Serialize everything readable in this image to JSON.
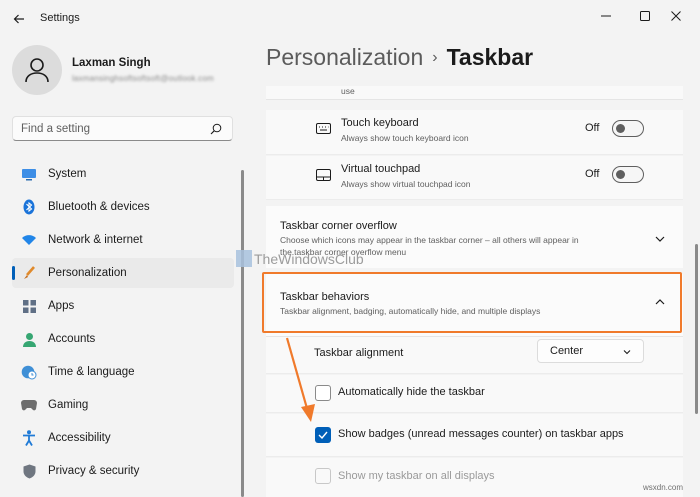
{
  "window": {
    "title": "Settings"
  },
  "profile": {
    "name": "Laxman Singh",
    "email": "laxmansinghsoftsoftsoft@outlook.com"
  },
  "search": {
    "placeholder": "Find a setting"
  },
  "nav": {
    "items": [
      {
        "label": "System",
        "icon": "monitor-icon",
        "active": false
      },
      {
        "label": "Bluetooth & devices",
        "icon": "bluetooth-icon",
        "active": false
      },
      {
        "label": "Network & internet",
        "icon": "wifi-icon",
        "active": false
      },
      {
        "label": "Personalization",
        "icon": "brush-icon",
        "active": true
      },
      {
        "label": "Apps",
        "icon": "apps-grid-icon",
        "active": false
      },
      {
        "label": "Accounts",
        "icon": "person-icon",
        "active": false
      },
      {
        "label": "Time & language",
        "icon": "globe-clock-icon",
        "active": false
      },
      {
        "label": "Gaming",
        "icon": "gamepad-icon",
        "active": false
      },
      {
        "label": "Accessibility",
        "icon": "accessibility-icon",
        "active": false
      },
      {
        "label": "Privacy & security",
        "icon": "shield-icon",
        "active": false
      }
    ]
  },
  "header": {
    "parent": "Personalization",
    "separator": "›",
    "current": "Taskbar"
  },
  "content": {
    "clipped_text": "use",
    "touch_keyboard": {
      "title": "Touch keyboard",
      "desc": "Always show touch keyboard icon",
      "state": "Off"
    },
    "virtual_touchpad": {
      "title": "Virtual touchpad",
      "desc": "Always show virtual touchpad icon",
      "state": "Off"
    },
    "corner_overflow": {
      "title": "Taskbar corner overflow",
      "desc_line1": "Choose which icons may appear in the taskbar corner – all others will appear in",
      "desc_line2": "the taskbar corner overflow menu"
    },
    "behaviors": {
      "title": "Taskbar behaviors",
      "desc": "Taskbar alignment, badging, automatically hide, and multiple displays",
      "alignment_label": "Taskbar alignment",
      "alignment_value": "Center",
      "auto_hide": "Automatically hide the taskbar",
      "auto_hide_checked": false,
      "badges": "Show badges (unread messages counter) on taskbar apps",
      "badges_checked": true,
      "all_displays": "Show my taskbar on all displays",
      "all_displays_checked": false
    }
  },
  "overlays": {
    "watermark": "TheWindowsClub",
    "corner_watermark": "wsxdn.com",
    "highlight_color": "#f07a2b",
    "accent_color": "#005fb8"
  }
}
